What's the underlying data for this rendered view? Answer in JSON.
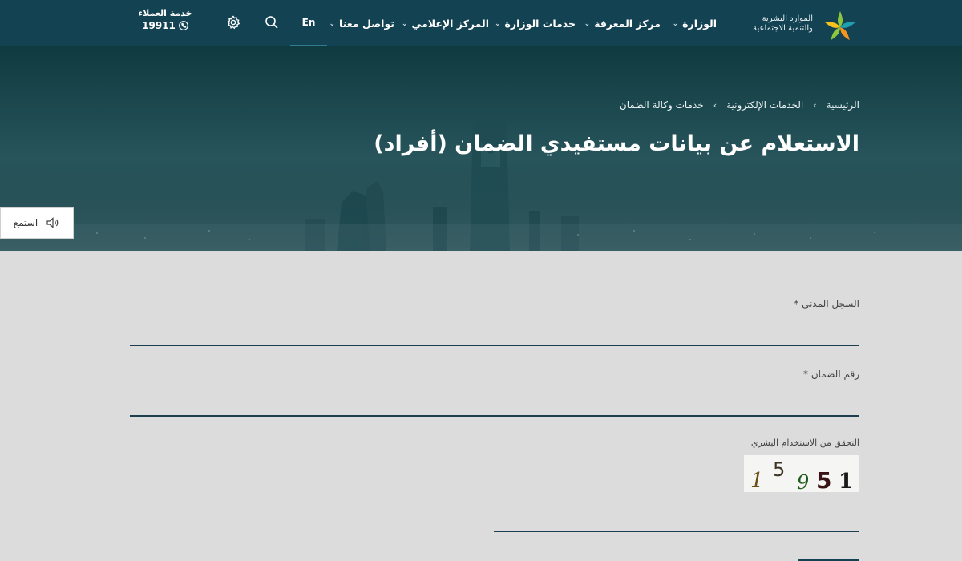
{
  "header": {
    "logo_text_line1": "الموارد البشرية",
    "logo_text_line2": "والتنمية الاجتماعية",
    "nav": [
      {
        "label": "الوزارة",
        "has_dropdown": true
      },
      {
        "label": "مركز المعرفة",
        "has_dropdown": true
      },
      {
        "label": "خدمات الوزارة",
        "has_dropdown": true
      },
      {
        "label": "المركز الإعلامي",
        "has_dropdown": true
      },
      {
        "label": "تواصل معنا",
        "has_dropdown": true
      }
    ],
    "language_toggle": "En",
    "search_icon": "search-icon",
    "settings_icon": "gear-icon",
    "customer_service": {
      "title": "خدمة العملاء",
      "phone": "19911",
      "icon": "phone-icon"
    }
  },
  "hero": {
    "breadcrumb": [
      "الرئيسية",
      "الخدمات الإلكترونية",
      "خدمات وكالة الضمان"
    ],
    "title": "الاستعلام عن بيانات مستفيدي الضمان (أفراد)",
    "listen_label": "استمع",
    "listen_icon": "speaker-icon"
  },
  "form": {
    "civil_id_label": "السجل المدني *",
    "civil_id_value": "",
    "security_number_label": "رقم الضمان *",
    "security_number_value": "",
    "captcha_label": "التحقق من الاستخدام البشري",
    "captcha_value": "",
    "captcha_digits": [
      "1",
      "5",
      "9",
      "5",
      "1"
    ]
  },
  "colors": {
    "header_bg": "#134252",
    "page_bg": "#dcdcdc",
    "field_underline": "#1b3e50",
    "logo_green": "#8cc63f",
    "logo_orange": "#f7941d",
    "logo_teal": "#1f9fb0"
  }
}
